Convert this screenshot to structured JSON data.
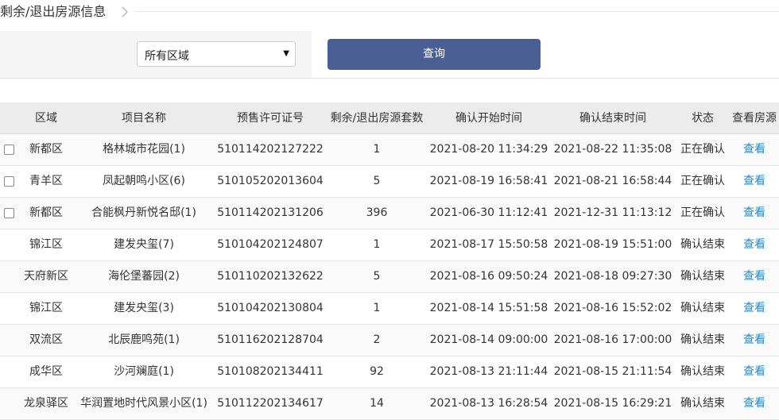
{
  "breadcrumb": {
    "title": "剩余/退出房源信息"
  },
  "filter": {
    "region_select": {
      "selected": "所有区域"
    },
    "query_label": "查询"
  },
  "table": {
    "headers": {
      "area": "区域",
      "project": "项目名称",
      "license": "预售许可证号",
      "count": "剩余/退出房源套数",
      "start": "确认开始时间",
      "end": "确认结束时间",
      "status": "状态",
      "view": "查看房源"
    },
    "rows": [
      {
        "checkbox": true,
        "area": "新都区",
        "project": "格林城市花园(1)",
        "license": "510114202127222",
        "count": "1",
        "start": "2021-08-20 11:34:29",
        "end": "2021-08-22 11:35:08",
        "status": "正在确认",
        "view": "查看"
      },
      {
        "checkbox": true,
        "area": "青羊区",
        "project": "凤起朝鸣小区(6)",
        "license": "510105202013604",
        "count": "5",
        "start": "2021-08-19 16:58:41",
        "end": "2021-08-21 16:58:44",
        "status": "正在确认",
        "view": "查看"
      },
      {
        "checkbox": true,
        "area": "新都区",
        "project": "合能枫丹新悦名邸(1)",
        "license": "510114202131206",
        "count": "396",
        "start": "2021-06-30 11:12:41",
        "end": "2021-12-31 11:13:12",
        "status": "正在确认",
        "view": "查看"
      },
      {
        "checkbox": false,
        "area": "锦江区",
        "project": "建发央玺(7)",
        "license": "510104202124807",
        "count": "1",
        "start": "2021-08-17 15:50:58",
        "end": "2021-08-19 15:51:00",
        "status": "确认结束",
        "view": "查看"
      },
      {
        "checkbox": false,
        "area": "天府新区",
        "project": "海伦堡蕃园(2)",
        "license": "510110202132622",
        "count": "5",
        "start": "2021-08-16 09:50:24",
        "end": "2021-08-18 09:27:30",
        "status": "确认结束",
        "view": "查看"
      },
      {
        "checkbox": false,
        "area": "锦江区",
        "project": "建发央玺(3)",
        "license": "510104202130804",
        "count": "1",
        "start": "2021-08-14 15:51:58",
        "end": "2021-08-16 15:52:02",
        "status": "确认结束",
        "view": "查看"
      },
      {
        "checkbox": false,
        "area": "双流区",
        "project": "北辰鹿鸣苑(1)",
        "license": "510116202128704",
        "count": "2",
        "start": "2021-08-14 09:00:00",
        "end": "2021-08-16 17:00:00",
        "status": "确认结束",
        "view": "查看"
      },
      {
        "checkbox": false,
        "area": "成华区",
        "project": "沙河斓庭(1)",
        "license": "510108202134411",
        "count": "92",
        "start": "2021-08-13 21:11:44",
        "end": "2021-08-15 21:11:54",
        "status": "确认结束",
        "view": "查看"
      },
      {
        "checkbox": false,
        "area": "龙泉驿区",
        "project": "华润置地时代风景小区(1)",
        "license": "510112202134617",
        "count": "14",
        "start": "2021-08-13 16:28:54",
        "end": "2021-08-15 16:29:21",
        "status": "确认结束",
        "view": "查看"
      }
    ]
  },
  "colors": {
    "accent_button": "#4a6094",
    "link": "#2e86c8",
    "header_bg": "#ececec",
    "filter_bg": "#f5f5f5"
  }
}
